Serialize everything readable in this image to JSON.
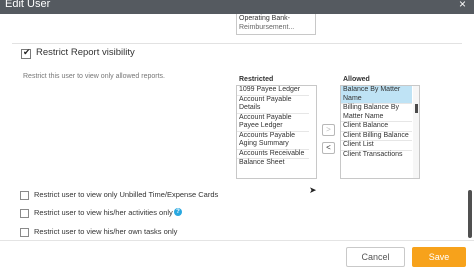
{
  "dialog": {
    "title": "Edit User",
    "close_glyph": "×"
  },
  "top_list": {
    "items": [
      "Operating Bank-",
      "Reimbursement..."
    ]
  },
  "report_visibility": {
    "checked": true,
    "check_glyph": "✔",
    "title": "Restrict Report visibility",
    "description": "Restrict this user to view only allowed reports.",
    "restricted_label": "Restricted",
    "allowed_label": "Allowed",
    "restricted_items": [
      "1099 Payee Ledger",
      "Account Payable Details",
      "Account Payable Payee Ledger",
      "Accounts Payable Aging Summary",
      "Accounts Receivable",
      "Balance Sheet"
    ],
    "allowed_items": [
      "Balance By Matter Name",
      "Billing Balance By Matter Name",
      "Client Balance",
      "Client Billing Balance",
      "Client List",
      "Client Transactions"
    ],
    "allowed_selected_index": 0,
    "move_right_glyph": ">",
    "move_left_glyph": "<"
  },
  "options": [
    {
      "label": "Restrict user to view only Unbilled Time/Expense Cards",
      "checked": false
    },
    {
      "label": "Restrict user to view his/her activities only",
      "checked": false,
      "help_glyph": "?"
    },
    {
      "label": "Restrict user to view his/her own tasks only",
      "checked": false
    }
  ],
  "footer": {
    "cancel_label": "Cancel",
    "save_label": "Save"
  },
  "colors": {
    "titlebar": "#555a60",
    "save_button": "#f7a21b",
    "selection": "#bfe3f5",
    "help_icon": "#29a8e0"
  }
}
